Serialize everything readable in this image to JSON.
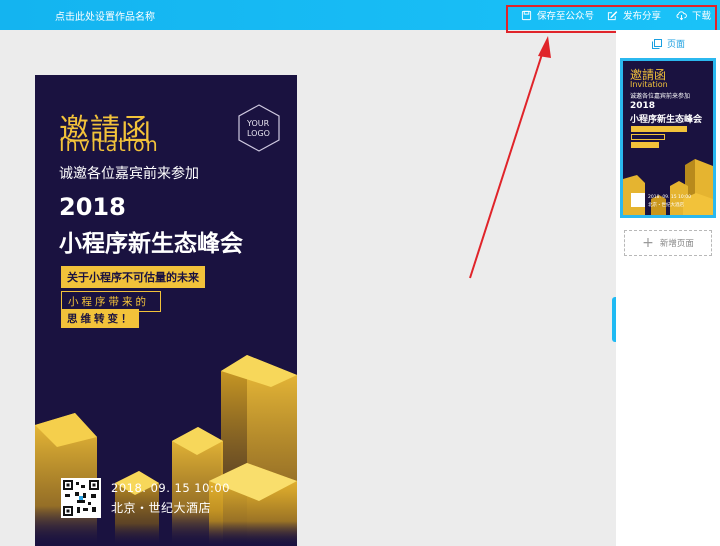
{
  "topbar": {
    "work_title": "点击此处设置作品名称",
    "save_label": "保存至公众号",
    "publish_label": "发布分享",
    "download_label": "下载",
    "bg_color": "#1ab8f4"
  },
  "poster": {
    "invite_cn": "邀請函",
    "invite_en": "Invitation",
    "logo_line1": "YOUR",
    "logo_line2": "LOGO",
    "subtitle": "诚邀各位嘉宾前来参加",
    "year": "2018",
    "event_title": "小程序新生态峰会",
    "tag1": "关于小程序不可估量的未来",
    "tag2": "小程序带来的",
    "tag3": "思维转变！",
    "date": "2018. 09. 15 10:00",
    "venue": "北京・世纪大酒店",
    "bg_color": "#1a1240",
    "accent_color": "#f2c23a"
  },
  "side_panel": {
    "header_label": "页面",
    "add_page_label": "新增页面",
    "thumbnail": {
      "invite_cn": "邀請函",
      "invite_en": "Invitation",
      "subtitle": "诚邀各位嘉宾前来参加",
      "year": "2018",
      "event_title": "小程序新生态峰会",
      "date": "2018. 09. 15 10:00",
      "venue": "北京・世纪大酒店"
    }
  },
  "annotation": {
    "highlight_color": "#e0242a"
  }
}
